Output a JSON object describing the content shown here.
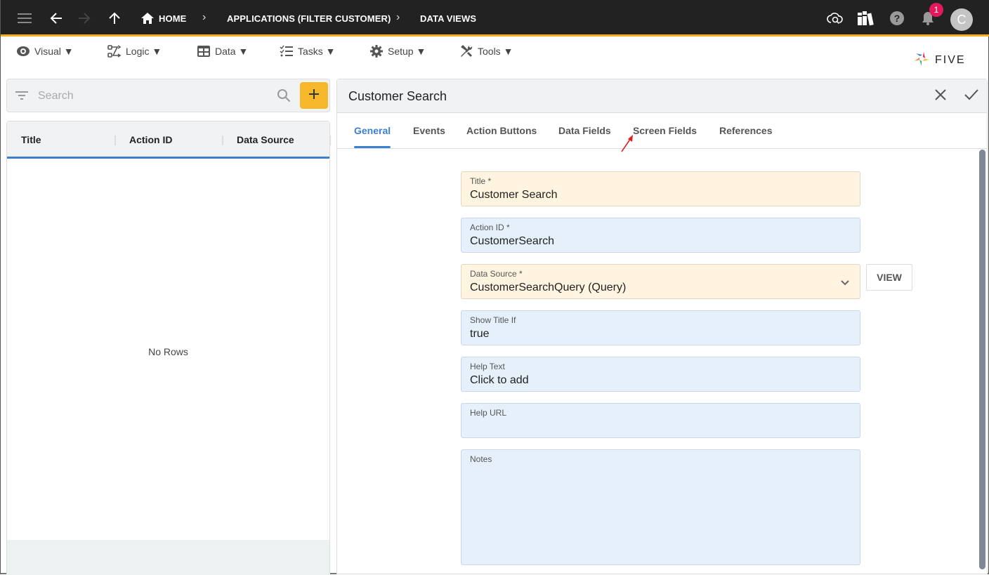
{
  "topbar": {
    "icons": [
      "menu-icon",
      "back-icon",
      "forward-icon",
      "up-icon"
    ],
    "breadcrumbs": [
      "HOME",
      "APPLICATIONS (FILTER CUSTOMER)",
      "DATA VIEWS"
    ],
    "notification_count": "1",
    "avatar_initial": "C",
    "accent_color": "#f2b01e"
  },
  "menubar": {
    "items": [
      {
        "label": "Visual ▼",
        "icon": "eye-icon"
      },
      {
        "label": "Logic ▼",
        "icon": "logic-icon"
      },
      {
        "label": "Data ▼",
        "icon": "table-icon"
      },
      {
        "label": "Tasks ▼",
        "icon": "tasks-icon"
      },
      {
        "label": "Setup ▼",
        "icon": "gear-icon"
      },
      {
        "label": "Tools ▼",
        "icon": "tools-icon"
      }
    ],
    "logo_text": "FIVE"
  },
  "list": {
    "search_placeholder": "Search",
    "columns": [
      "Title",
      "Action ID",
      "Data Source"
    ],
    "empty_text": "No Rows"
  },
  "form": {
    "title": "Customer Search",
    "tabs": [
      "General",
      "Events",
      "Action Buttons",
      "Data Fields",
      "Screen Fields",
      "References"
    ],
    "active_tab": "General",
    "fields": {
      "title": {
        "label": "Title *",
        "value": "Customer Search"
      },
      "action_id": {
        "label": "Action ID *",
        "value": "CustomerSearch"
      },
      "data_source": {
        "label": "Data Source *",
        "value": "CustomerSearchQuery (Query)"
      },
      "show_title_if": {
        "label": "Show Title If",
        "value": "true"
      },
      "help_text": {
        "label": "Help Text",
        "value": "Click to add"
      },
      "help_url": {
        "label": "Help URL",
        "value": ""
      },
      "notes": {
        "label": "Notes",
        "value": ""
      }
    },
    "view_button": "VIEW"
  }
}
